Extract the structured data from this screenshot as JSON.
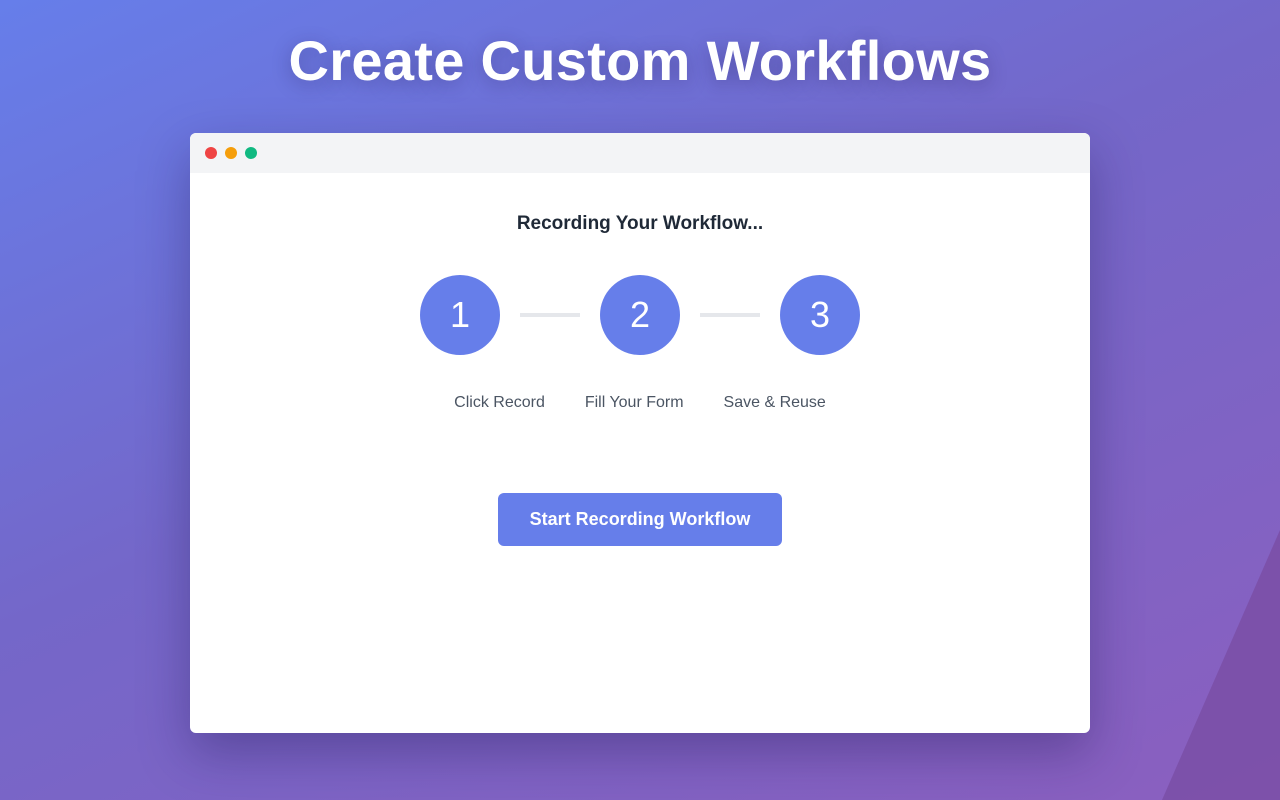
{
  "page": {
    "headline": "Create Custom Workflows"
  },
  "window": {
    "title_dots": [
      "close",
      "minimize",
      "maximize"
    ],
    "status_text": "Recording Your Workflow...",
    "steps": [
      {
        "number": "1",
        "label": "Click Record"
      },
      {
        "number": "2",
        "label": "Fill Your Form"
      },
      {
        "number": "3",
        "label": "Save & Reuse"
      }
    ],
    "cta_label": "Start Recording Workflow"
  },
  "colors": {
    "accent": "#667eea",
    "gradient_start": "#667eea",
    "gradient_end": "#8b5fbf",
    "dot_red": "#ef4444",
    "dot_yellow": "#f59e0b",
    "dot_green": "#10b981",
    "connector": "#e5e7eb"
  }
}
